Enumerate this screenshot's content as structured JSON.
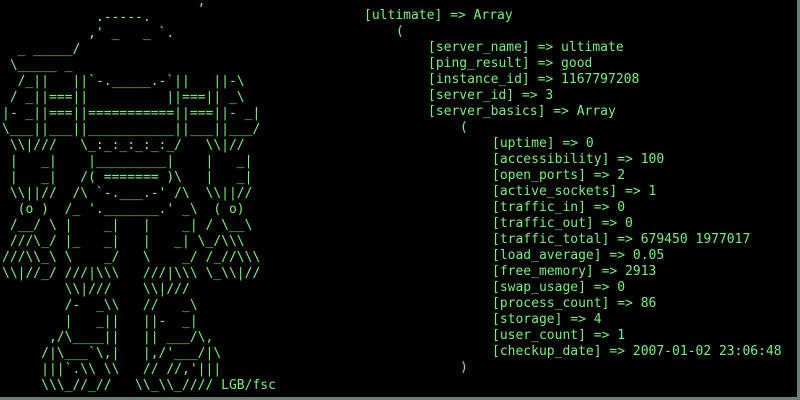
{
  "ascii_art": {
    "lines": [
      "                         ,'",
      "            .-----.",
      "           ,' _   _ `.",
      "  _ _____/",
      " \\_____ _",
      "  /_||   ||`-._____.-`||   ||-\\",
      " / _||===||          ||===|| _\\",
      "|- _||===||===========||===||- _|",
      "\\___||___||___________||___||___/",
      " \\\\|///   \\_:_:_:_:_:_/   \\\\|//",
      " |   _|    |_________|    |   _|",
      " |   _|   /( ======= )\\   |   _|",
      " \\\\||//  /\\ `-.___.-' /\\  \\\\||//",
      "  (o )  /_ '._______.' _\\  ( o)",
      " /__/ \\ |    _|   |    _| / \\__\\",
      " ///\\_/ |_   _|   |   _| \\_/\\\\\\",
      "///\\\\_\\ \\    _/   \\    _/ /_//\\\\\\",
      "\\\\|//_/ ///|\\\\\\   ///|\\\\\\ \\_\\\\|//",
      "        \\\\|///    \\\\|///",
      "        /-  _\\\\   //   _\\",
      "        |   _||   ||-  _|",
      "      ,/\\____||   || ___/\\,",
      "     /|\\___`\\,|   |,/'___/|\\",
      "     |||`.\\\\ \\\\   // //,'|||",
      "     \\\\\\_//_//   \\\\_\\\\_//// LGB/fsc"
    ]
  },
  "array_dump": {
    "header": "[ultimate] => Array",
    "open_paren": "(",
    "fields": [
      "[server_name] => ultimate",
      "[ping_result] => good",
      "[instance_id] => 1167797208",
      "[server_id] => 3",
      "[server_basics] => Array"
    ],
    "inner_open_paren": "(",
    "basics": [
      "[uptime] => 0",
      "[accessibility] => 100",
      "[open_ports] => 2",
      "[active_sockets] => 1",
      "[traffic_in] => 0",
      "[traffic_out] => 0",
      "[traffic_total] => 679450 1977017",
      "[load_average] => 0.05",
      "[free_memory] => 2913",
      "[swap_usage] => 0",
      "[process_count] => 86",
      "[storage] => 4",
      "[user_count] => 1",
      "[checkup_date] => 2007-01-02 23:06:48"
    ],
    "inner_close_paren": ")"
  },
  "colors": {
    "background": "#000000",
    "text": "#74f274",
    "edge": "#6f7f6f"
  }
}
